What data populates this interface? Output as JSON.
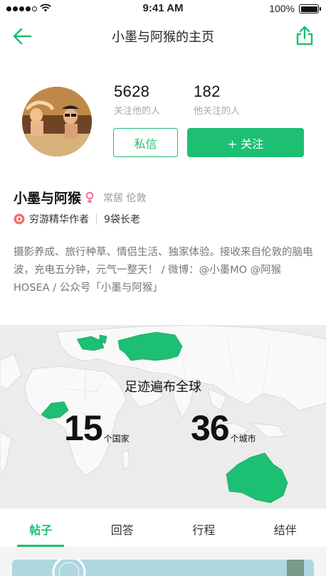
{
  "status_bar": {
    "time": "9:41 AM",
    "battery": "100%"
  },
  "nav": {
    "title": "小墨与阿猴的主页",
    "back_icon": "arrow-left-icon",
    "share_icon": "share-icon"
  },
  "colors": {
    "accent": "#1dbf73",
    "text": "#222222",
    "muted": "#999999",
    "map_bg": "#ececec"
  },
  "profile": {
    "followers": {
      "count": "5628",
      "label": "关注他的人"
    },
    "following": {
      "count": "182",
      "label": "他关注的人"
    },
    "message_button": "私信",
    "follow_button": "+ 关注",
    "name": "小墨与阿猴",
    "gender": "female",
    "location": "常居 伦敦",
    "badge": "穷游精华作者",
    "level": "9袋长老",
    "bio": "摄影养成、旅行种草、情侣生活、独家体验。接收来自伦敦的脑电波，充电五分钟，元气一整天！ / 微博：@小墨MO @阿猴HOSEA / 公众号「小墨与阿猴」"
  },
  "map": {
    "title": "足迹遍布全球",
    "countries": {
      "count": "15",
      "unit": "个国家"
    },
    "cities": {
      "count": "36",
      "unit": "个城市"
    }
  },
  "tabs": [
    {
      "label": "帖子",
      "active": true
    },
    {
      "label": "回答",
      "active": false
    },
    {
      "label": "行程",
      "active": false
    },
    {
      "label": "结伴",
      "active": false
    }
  ]
}
